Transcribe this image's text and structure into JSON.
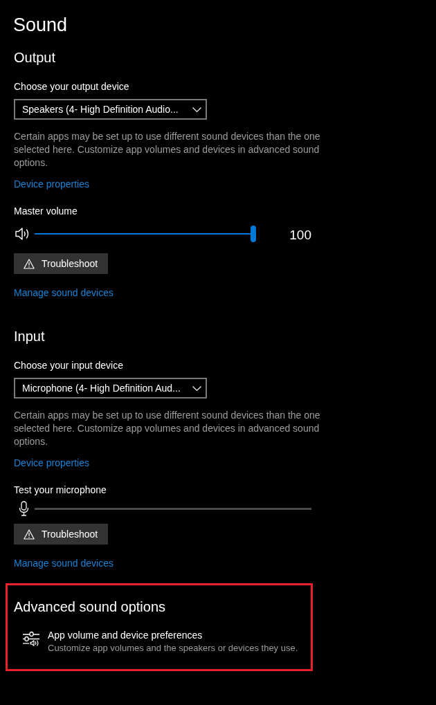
{
  "page_title": "Sound",
  "sections": [
    {
      "heading": "Output",
      "device_label": "Choose your output device",
      "device_dropdown": {
        "value": "Speakers (4- High Definition Audio..."
      },
      "description": "Certain apps may be set up to use different sound devices than the one selected here. Customize app volumes and devices in advanced sound options.",
      "properties_link": "Device properties",
      "level_label": "Master volume",
      "level_control": {
        "kind": "slider",
        "level": 1,
        "reading": "100"
      },
      "troubleshoot_button": "Troubleshoot",
      "manage_link": "Manage sound devices"
    },
    {
      "heading": "Input",
      "device_label": "Choose your input device",
      "device_dropdown": {
        "value": "Microphone (4- High Definition Aud..."
      },
      "description": "Certain apps may be set up to use different sound devices than the one selected here. Customize app volumes and devices in advanced sound options.",
      "properties_link": "Device properties",
      "level_label": "Test your microphone",
      "level_control": {
        "kind": "meter",
        "level": 0
      },
      "troubleshoot_button": "Troubleshoot",
      "manage_link": "Manage sound devices"
    }
  ],
  "advanced": {
    "heading": "Advanced sound options",
    "highlighted": true,
    "entries": [
      {
        "title": "App volume and device preferences",
        "description": "Customize app volumes and the speakers or devices they use."
      }
    ]
  }
}
